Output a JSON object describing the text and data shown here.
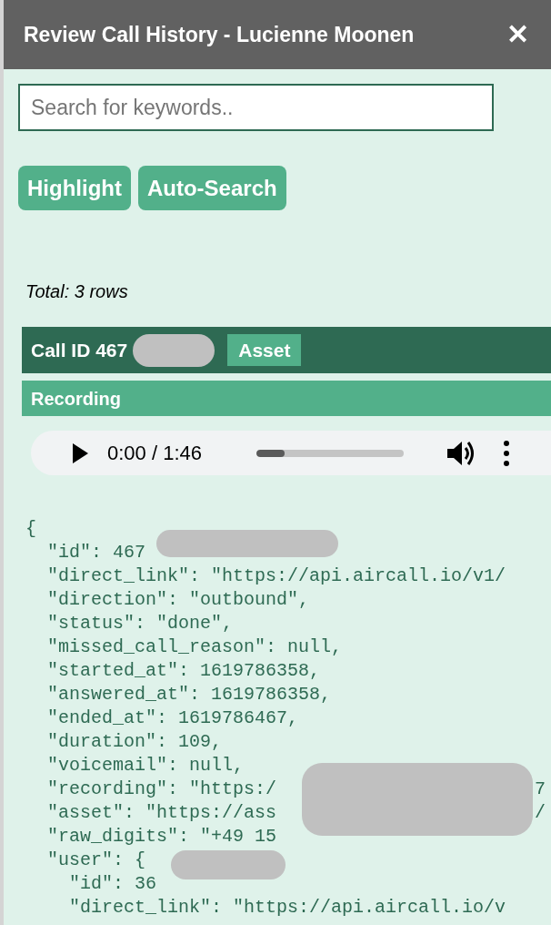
{
  "window": {
    "title": "Review Call History - Lucienne Moonen",
    "close": "✕"
  },
  "search": {
    "placeholder": "Search for keywords.."
  },
  "buttons": [
    "Highlight",
    "Auto-Search"
  ],
  "total": "Total: 3 rows",
  "call": {
    "title": "Call ID 467",
    "badge": "Asset",
    "section": "Recording"
  },
  "player": {
    "time": "0:00 / 1:46",
    "level": 0.19
  },
  "code_lines": [
    {
      "text": "{"
    },
    {
      "text": "  \"id\": 467",
      "redacted": true
    },
    {
      "text": "  \"direct_link\": \"https://api.aircall.io/v1/"
    },
    {
      "text": "  \"direction\": \"outbound\","
    },
    {
      "text": "  \"status\": \"done\","
    },
    {
      "text": "  \"missed_call_reason\": null,"
    },
    {
      "text": "  \"started_at\": 1619786358,"
    },
    {
      "text": "  \"answered_at\": 1619786358,"
    },
    {
      "text": "  \"ended_at\": 1619786467,"
    },
    {
      "text": "  \"duration\": 109,"
    },
    {
      "text": "  \"voicemail\": null,"
    },
    {
      "text": "  \"recording\": \"https:/",
      "tail": "7",
      "redacted": true
    },
    {
      "text": "  \"asset\": \"https://ass",
      "tail": "/"
    },
    {
      "text": "  \"raw_digits\": \"+49 15"
    },
    {
      "text": "  \"user\": {"
    },
    {
      "text": "    \"id\": 36",
      "redacted": true
    },
    {
      "text": "    \"direct_link\": \"https://api.aircall.io/v"
    }
  ]
}
